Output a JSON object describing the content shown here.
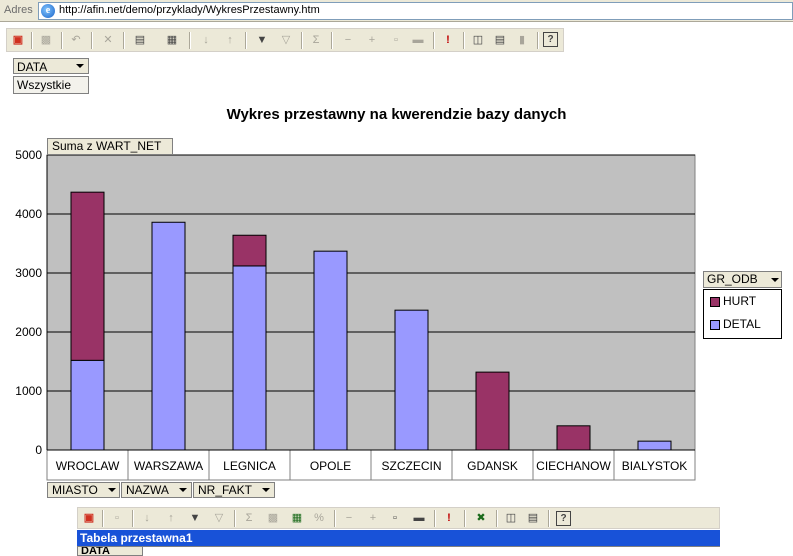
{
  "address_bar": {
    "label": "Adres",
    "url": "http://afin.net/demo/przyklady/WykresPrzestawny.htm"
  },
  "filter": {
    "field_label": "DATA",
    "value": "Wszystkie"
  },
  "chart": {
    "title": "Wykres przestawny na kwerendzie bazy danych",
    "value_field": "Suma z WART_NET",
    "series_field": "GR_ODB",
    "category_fields": [
      "MIASTO",
      "NAZWA",
      "NR_FAKT"
    ]
  },
  "colors": {
    "hurt": "#993366",
    "detal": "#9999ff",
    "plot_background": "#c0c0c0",
    "pivot_header": "#1852d8"
  },
  "chart_data": {
    "type": "bar",
    "stacked": true,
    "categories": [
      "WROCLAW",
      "WARSZAWA",
      "LEGNICA",
      "OPOLE",
      "SZCZECIN",
      "GDANSK",
      "CIECHANOW",
      "BIALYSTOK"
    ],
    "series": [
      {
        "name": "DETAL",
        "values": [
          1520,
          3860,
          3120,
          3370,
          2370,
          0,
          0,
          150
        ]
      },
      {
        "name": "HURT",
        "values": [
          2850,
          0,
          520,
          0,
          0,
          1320,
          410,
          0
        ]
      }
    ],
    "legend_order": [
      "HURT",
      "DETAL"
    ],
    "title": "Wykres przestawny na kwerendzie bazy danych",
    "ylabel": "Suma z WART_NET",
    "xlabel": "",
    "ylim": [
      0,
      5000
    ],
    "yticks": [
      0,
      1000,
      2000,
      3000,
      4000,
      5000
    ],
    "grid": true,
    "legend_position": "right"
  },
  "pivot_table": {
    "title": "Tabela przestawna1",
    "row_field": "DATA"
  }
}
